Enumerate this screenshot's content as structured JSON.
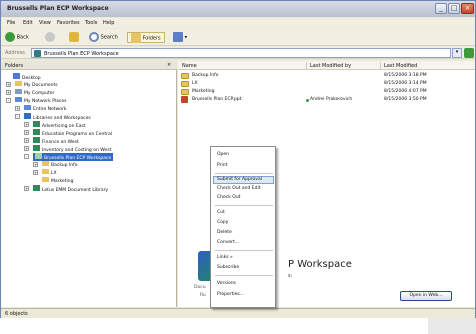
{
  "window": {
    "title": "Brussells Plan ECP Workspace"
  },
  "menubar": [
    "File",
    "Edit",
    "View",
    "Favorites",
    "Tools",
    "Help"
  ],
  "toolbar": {
    "back": "Back",
    "search": "Search",
    "folders": "Folders"
  },
  "address": {
    "label": "Address",
    "value": "Brussells Plan ECP Workspace"
  },
  "left_pane": {
    "header": "Folders",
    "tree": [
      "Desktop",
      "My Documents",
      "My Computer",
      "My Network Places",
      "Entire Network",
      "Libraries and Workspaces",
      "Advertising on East",
      "Education Programs on Central",
      "Finance on West",
      "Inventory and Costing on West",
      "Brussells Plan ECP Workspace",
      "Backup Info",
      "LX",
      "Marketing",
      "Lotus EMM Document Library"
    ]
  },
  "columns": [
    "Name",
    "Last Modified by",
    "Last Modified"
  ],
  "files": [
    {
      "name": "Backup Info",
      "by": "",
      "date": "8/15/2006 3:18 PM"
    },
    {
      "name": "LX",
      "by": "",
      "date": "8/15/2006 3:14 PM"
    },
    {
      "name": "Marketing",
      "by": "",
      "date": "8/15/2006 4:07 PM"
    },
    {
      "name": "Brussells Plan ECP.ppt",
      "by": "Andrei Prakorovich",
      "date": "8/15/2006 3:50 PM"
    }
  ],
  "context_menu": [
    "Open",
    "Print",
    "Submit for Approval",
    "Check Out and Edit",
    "Check Out",
    "Cut",
    "Copy",
    "Delete",
    "Convert...",
    "Links »",
    "Subscribe",
    "Versions",
    "Properties..."
  ],
  "details": {
    "title": "P Workspace",
    "sub": "s:",
    "label1": "Docu",
    "label2": "Ru",
    "open_button": "Open in Web..."
  },
  "status": "6 objects",
  "colors": {
    "accent": "#316ac5",
    "folder": "#e7c463"
  }
}
